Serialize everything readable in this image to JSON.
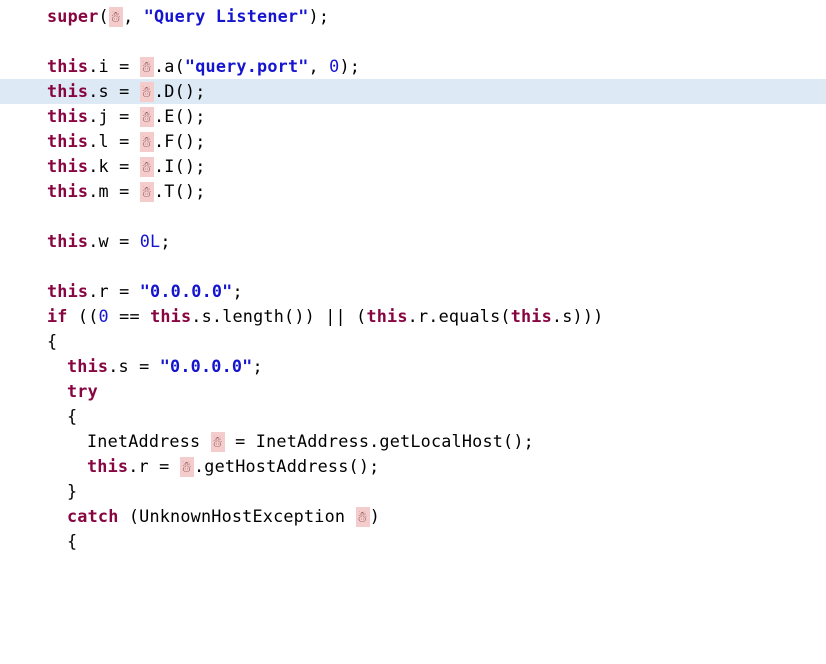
{
  "obfuscated_glyph": "☃",
  "lines": [
    {
      "indent": 0,
      "highlighted": false,
      "segments": [
        {
          "cls": "kw",
          "text": "super"
        },
        {
          "cls": "plain",
          "text": "("
        },
        {
          "cls": "obf",
          "text": "☃"
        },
        {
          "cls": "plain",
          "text": ", "
        },
        {
          "cls": "str",
          "text": "\"Query Listener\""
        },
        {
          "cls": "plain",
          "text": ");"
        }
      ]
    },
    {
      "indent": 0,
      "highlighted": false,
      "segments": [
        {
          "cls": "plain",
          "text": " "
        }
      ]
    },
    {
      "indent": 0,
      "highlighted": false,
      "segments": [
        {
          "cls": "kw",
          "text": "this"
        },
        {
          "cls": "plain",
          "text": ".i = "
        },
        {
          "cls": "obf",
          "text": "☃"
        },
        {
          "cls": "plain",
          "text": ".a("
        },
        {
          "cls": "str",
          "text": "\"query.port\""
        },
        {
          "cls": "plain",
          "text": ", "
        },
        {
          "cls": "num",
          "text": "0"
        },
        {
          "cls": "plain",
          "text": ");"
        }
      ]
    },
    {
      "indent": 0,
      "highlighted": true,
      "segments": [
        {
          "cls": "kw",
          "text": "this"
        },
        {
          "cls": "plain",
          "text": ".s = "
        },
        {
          "cls": "obf",
          "text": "☃"
        },
        {
          "cls": "plain",
          "text": ".D();"
        }
      ]
    },
    {
      "indent": 0,
      "highlighted": false,
      "segments": [
        {
          "cls": "kw",
          "text": "this"
        },
        {
          "cls": "plain",
          "text": ".j = "
        },
        {
          "cls": "obf",
          "text": "☃"
        },
        {
          "cls": "plain",
          "text": ".E();"
        }
      ]
    },
    {
      "indent": 0,
      "highlighted": false,
      "segments": [
        {
          "cls": "kw",
          "text": "this"
        },
        {
          "cls": "plain",
          "text": ".l = "
        },
        {
          "cls": "obf",
          "text": "☃"
        },
        {
          "cls": "plain",
          "text": ".F();"
        }
      ]
    },
    {
      "indent": 0,
      "highlighted": false,
      "segments": [
        {
          "cls": "kw",
          "text": "this"
        },
        {
          "cls": "plain",
          "text": ".k = "
        },
        {
          "cls": "obf",
          "text": "☃"
        },
        {
          "cls": "plain",
          "text": ".I();"
        }
      ]
    },
    {
      "indent": 0,
      "highlighted": false,
      "segments": [
        {
          "cls": "kw",
          "text": "this"
        },
        {
          "cls": "plain",
          "text": ".m = "
        },
        {
          "cls": "obf",
          "text": "☃"
        },
        {
          "cls": "plain",
          "text": ".T();"
        }
      ]
    },
    {
      "indent": 0,
      "highlighted": false,
      "segments": [
        {
          "cls": "plain",
          "text": " "
        }
      ]
    },
    {
      "indent": 0,
      "highlighted": false,
      "segments": [
        {
          "cls": "kw",
          "text": "this"
        },
        {
          "cls": "plain",
          "text": ".w = "
        },
        {
          "cls": "num",
          "text": "0L"
        },
        {
          "cls": "plain",
          "text": ";"
        }
      ]
    },
    {
      "indent": 0,
      "highlighted": false,
      "segments": [
        {
          "cls": "plain",
          "text": " "
        }
      ]
    },
    {
      "indent": 0,
      "highlighted": false,
      "segments": [
        {
          "cls": "kw",
          "text": "this"
        },
        {
          "cls": "plain",
          "text": ".r = "
        },
        {
          "cls": "str",
          "text": "\"0.0.0.0\""
        },
        {
          "cls": "plain",
          "text": ";"
        }
      ]
    },
    {
      "indent": 0,
      "highlighted": false,
      "segments": [
        {
          "cls": "kw",
          "text": "if"
        },
        {
          "cls": "plain",
          "text": " (("
        },
        {
          "cls": "num",
          "text": "0"
        },
        {
          "cls": "plain",
          "text": " == "
        },
        {
          "cls": "kw",
          "text": "this"
        },
        {
          "cls": "plain",
          "text": ".s.length()) || ("
        },
        {
          "cls": "kw",
          "text": "this"
        },
        {
          "cls": "plain",
          "text": ".r.equals("
        },
        {
          "cls": "kw",
          "text": "this"
        },
        {
          "cls": "plain",
          "text": ".s)))"
        }
      ]
    },
    {
      "indent": 0,
      "highlighted": false,
      "segments": [
        {
          "cls": "plain",
          "text": "{"
        }
      ]
    },
    {
      "indent": 1,
      "highlighted": false,
      "segments": [
        {
          "cls": "kw",
          "text": "this"
        },
        {
          "cls": "plain",
          "text": ".s = "
        },
        {
          "cls": "str",
          "text": "\"0.0.0.0\""
        },
        {
          "cls": "plain",
          "text": ";"
        }
      ]
    },
    {
      "indent": 1,
      "highlighted": false,
      "segments": [
        {
          "cls": "kw",
          "text": "try"
        }
      ]
    },
    {
      "indent": 1,
      "highlighted": false,
      "segments": [
        {
          "cls": "plain",
          "text": "{"
        }
      ]
    },
    {
      "indent": 2,
      "highlighted": false,
      "segments": [
        {
          "cls": "plain",
          "text": "InetAddress "
        },
        {
          "cls": "obf",
          "text": "☃"
        },
        {
          "cls": "plain",
          "text": " = InetAddress.getLocalHost();"
        }
      ]
    },
    {
      "indent": 2,
      "highlighted": false,
      "segments": [
        {
          "cls": "kw",
          "text": "this"
        },
        {
          "cls": "plain",
          "text": ".r = "
        },
        {
          "cls": "obf",
          "text": "☃"
        },
        {
          "cls": "plain",
          "text": ".getHostAddress();"
        }
      ]
    },
    {
      "indent": 1,
      "highlighted": false,
      "segments": [
        {
          "cls": "plain",
          "text": "}"
        }
      ]
    },
    {
      "indent": 1,
      "highlighted": false,
      "segments": [
        {
          "cls": "kw",
          "text": "catch"
        },
        {
          "cls": "plain",
          "text": " (UnknownHostException "
        },
        {
          "cls": "obf",
          "text": "☃"
        },
        {
          "cls": "plain",
          "text": ")"
        }
      ]
    },
    {
      "indent": 1,
      "highlighted": false,
      "segments": [
        {
          "cls": "plain",
          "text": "{"
        }
      ]
    }
  ]
}
